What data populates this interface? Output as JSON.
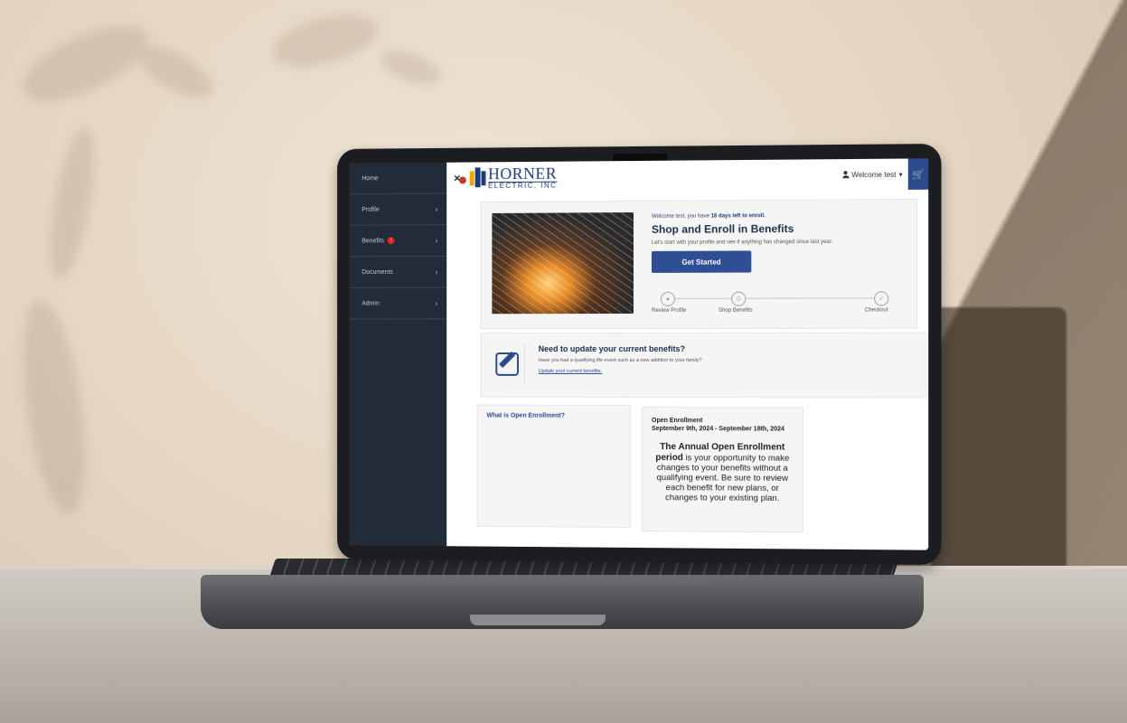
{
  "sidebar": {
    "items": [
      {
        "label": "Home",
        "has_chevron": false
      },
      {
        "label": "Profile",
        "has_chevron": true
      },
      {
        "label": "Benefits",
        "has_chevron": true,
        "badge": "!"
      },
      {
        "label": "Documents",
        "has_chevron": true
      },
      {
        "label": "Admin",
        "has_chevron": true
      }
    ]
  },
  "header": {
    "close_glyph": "×",
    "logo_main": "HORNER",
    "logo_sub": "ELECTRIC, INC",
    "welcome": "Welcome test",
    "welcome_caret": "▾",
    "cart_glyph": "🛒"
  },
  "hero": {
    "welcome_prefix": "Welcome test, you have",
    "welcome_bold": "16 days left to enroll.",
    "title": "Shop and Enroll in Benefits",
    "description": "Let's start with your profile and see if anything has changed since last year.",
    "button": "Get Started",
    "steps": [
      {
        "label": "Review Profile",
        "icon": "person-icon",
        "glyph": "●"
      },
      {
        "label": "Shop Benefits",
        "icon": "cart-icon",
        "glyph": "⊙"
      },
      {
        "label": "Checkout",
        "icon": "check-icon",
        "glyph": "✓"
      }
    ]
  },
  "update": {
    "title": "Need to update your current benefits?",
    "description": "Have you had a qualifying life event such as a new addition to your family?",
    "link": "Update your current benefits."
  },
  "open_enrollment": {
    "card_title": "What is Open Enrollment?",
    "dates_heading": "Open Enrollment",
    "dates": "September 9th, 2024 - September 18th, 2024",
    "body_bold": "The Annual Open Enrollment period",
    "body_rest": "is your opportunity to make changes to your benefits without a qualifying event. Be sure to review each benefit for new plans, or changes to your existing plan."
  },
  "colors": {
    "sidebar_bg": "#222b38",
    "accent": "#2f4f94",
    "brand_blue": "#1f3a7a",
    "brand_orange": "#f0a500"
  }
}
